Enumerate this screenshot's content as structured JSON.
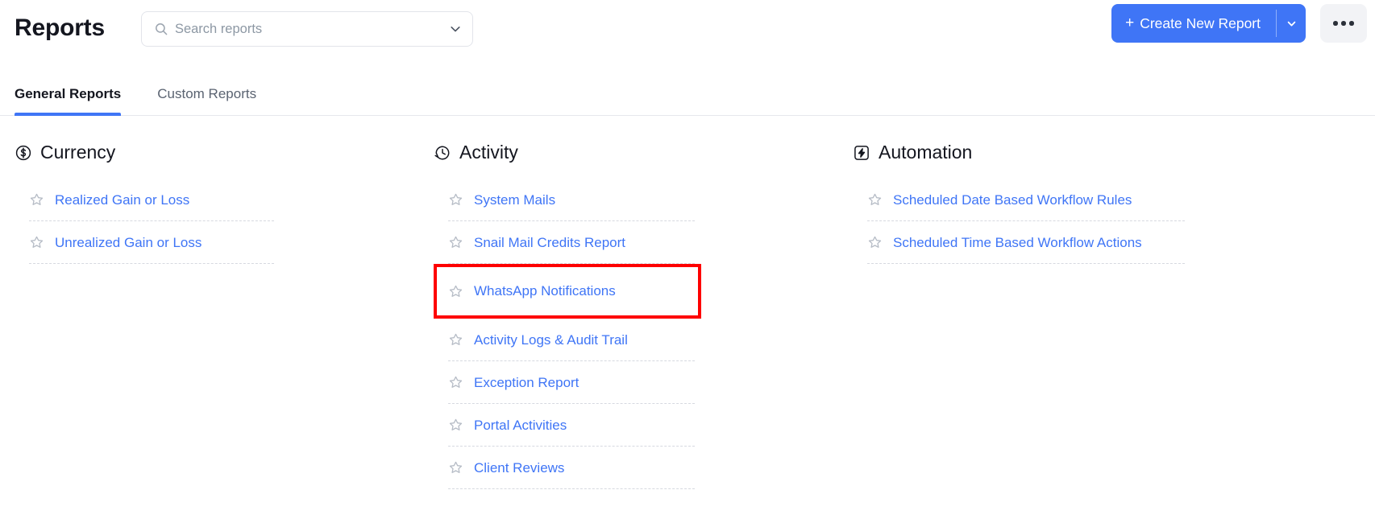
{
  "header": {
    "title": "Reports",
    "search": {
      "placeholder": "Search reports",
      "value": "",
      "icon": "search-icon",
      "caret_icon": "chevron-down-icon"
    },
    "create_button": {
      "label": "Create New Report",
      "plus": "+",
      "caret_icon": "chevron-down-icon",
      "color": "#3f75f6"
    },
    "more_button": {
      "icon": "ellipsis-icon"
    }
  },
  "tabs": [
    {
      "label": "General Reports",
      "active": true
    },
    {
      "label": "Custom Reports",
      "active": false
    }
  ],
  "columns": [
    {
      "key": "currency",
      "title": "Currency",
      "icon": "dollar-circle-icon",
      "items": [
        {
          "label": "Realized Gain or Loss",
          "favorite": false,
          "highlighted": false
        },
        {
          "label": "Unrealized Gain or Loss",
          "favorite": false,
          "highlighted": false
        }
      ]
    },
    {
      "key": "activity",
      "title": "Activity",
      "icon": "clock-history-icon",
      "items": [
        {
          "label": "System Mails",
          "favorite": false,
          "highlighted": false
        },
        {
          "label": "Snail Mail Credits Report",
          "favorite": false,
          "highlighted": false
        },
        {
          "label": "WhatsApp Notifications",
          "favorite": false,
          "highlighted": true
        },
        {
          "label": "Activity Logs & Audit Trail",
          "favorite": false,
          "highlighted": false
        },
        {
          "label": "Exception Report",
          "favorite": false,
          "highlighted": false
        },
        {
          "label": "Portal Activities",
          "favorite": false,
          "highlighted": false
        },
        {
          "label": "Client Reviews",
          "favorite": false,
          "highlighted": false
        }
      ]
    },
    {
      "key": "automation",
      "title": "Automation",
      "icon": "lightning-square-icon",
      "items": [
        {
          "label": "Scheduled Date Based Workflow Rules",
          "favorite": false,
          "highlighted": false
        },
        {
          "label": "Scheduled Time Based Workflow Actions",
          "favorite": false,
          "highlighted": false
        }
      ]
    }
  ],
  "highlight": {
    "color": "#fe0000",
    "target": "WhatsApp Notifications"
  }
}
